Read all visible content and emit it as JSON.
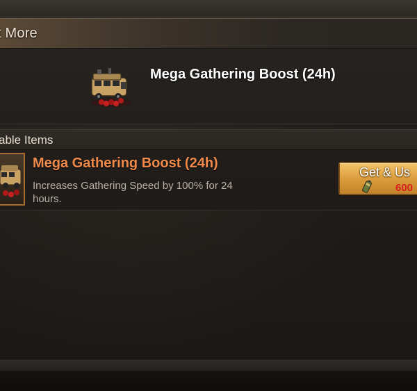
{
  "header": {
    "title": "t More"
  },
  "hero": {
    "title": "Mega Gathering Boost (24h)",
    "icon": "armored-truck-icon"
  },
  "section": {
    "title": "able Items"
  },
  "items": [
    {
      "name": "Mega Gathering Boost (24h)",
      "description": "Increases Gathering Speed by 100% for 24 hours.",
      "icon": "armored-truck-icon",
      "button_label": "Get & Us",
      "cost": "600",
      "cost_icon": "gold-canister-icon"
    }
  ],
  "colors": {
    "item_name": "#f08a4a",
    "cost": "#d81e1e",
    "button": "#e0a545"
  }
}
